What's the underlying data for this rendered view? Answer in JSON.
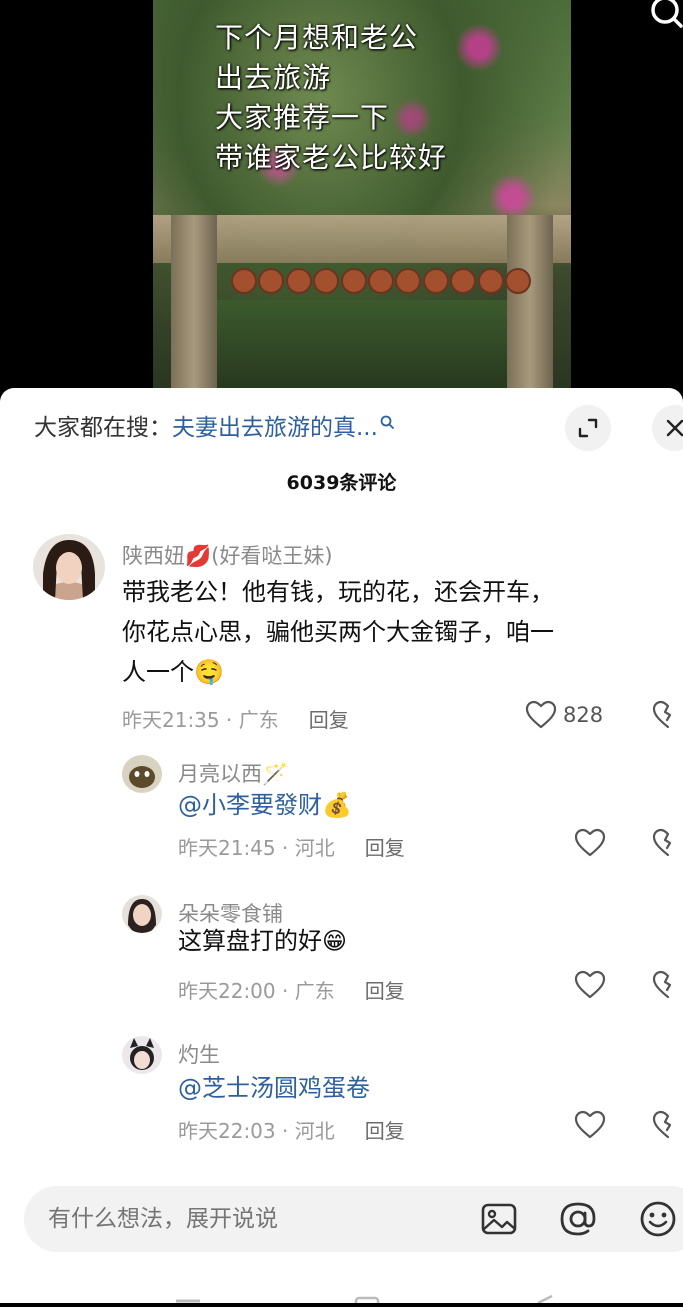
{
  "video": {
    "caption_lines": [
      "下个月想和老公",
      "出去旅游",
      "大家推荐一下",
      "带谁家老公比较好"
    ]
  },
  "sheet": {
    "hot_search_prefix": "大家都在搜：",
    "hot_search_query": "夫妻出去旅游的真...",
    "comment_count": "6039条评论"
  },
  "comments": [
    {
      "author": "陕西妞💋(好看哒王妹)",
      "text_lines": [
        "带我老公！他有钱，玩的花，还会开车，",
        "你花点心思，骗他买两个大金镯子，咱一",
        "人一个🤤"
      ],
      "time_location": "昨天21:35 · 广东",
      "reply_label": "回复",
      "likes": "828"
    },
    {
      "author": "月亮以西🪄",
      "text": "@小李要發财💰",
      "time_location": "昨天21:45 · 河北",
      "reply_label": "回复"
    },
    {
      "author": "朵朵零食铺",
      "text": "这算盘打的好😁",
      "time_location": "昨天22:00 · 广东",
      "reply_label": "回复"
    },
    {
      "author": "灼生",
      "text": "@芝士汤圆鸡蛋卷",
      "time_location": "昨天22:03 · 河北",
      "reply_label": "回复"
    }
  ],
  "input": {
    "placeholder": "有什么想法，展开说说"
  },
  "icons": [
    "search-icon",
    "expand-icon",
    "close-icon",
    "heart-icon",
    "broken-heart-icon",
    "image-icon",
    "at-icon",
    "emoji-icon"
  ],
  "colors": {
    "link": "#2e5f9e",
    "meta": "#9a9a9a",
    "sheet_bg": "#ffffff",
    "input_bg": "#f2f2f2"
  }
}
